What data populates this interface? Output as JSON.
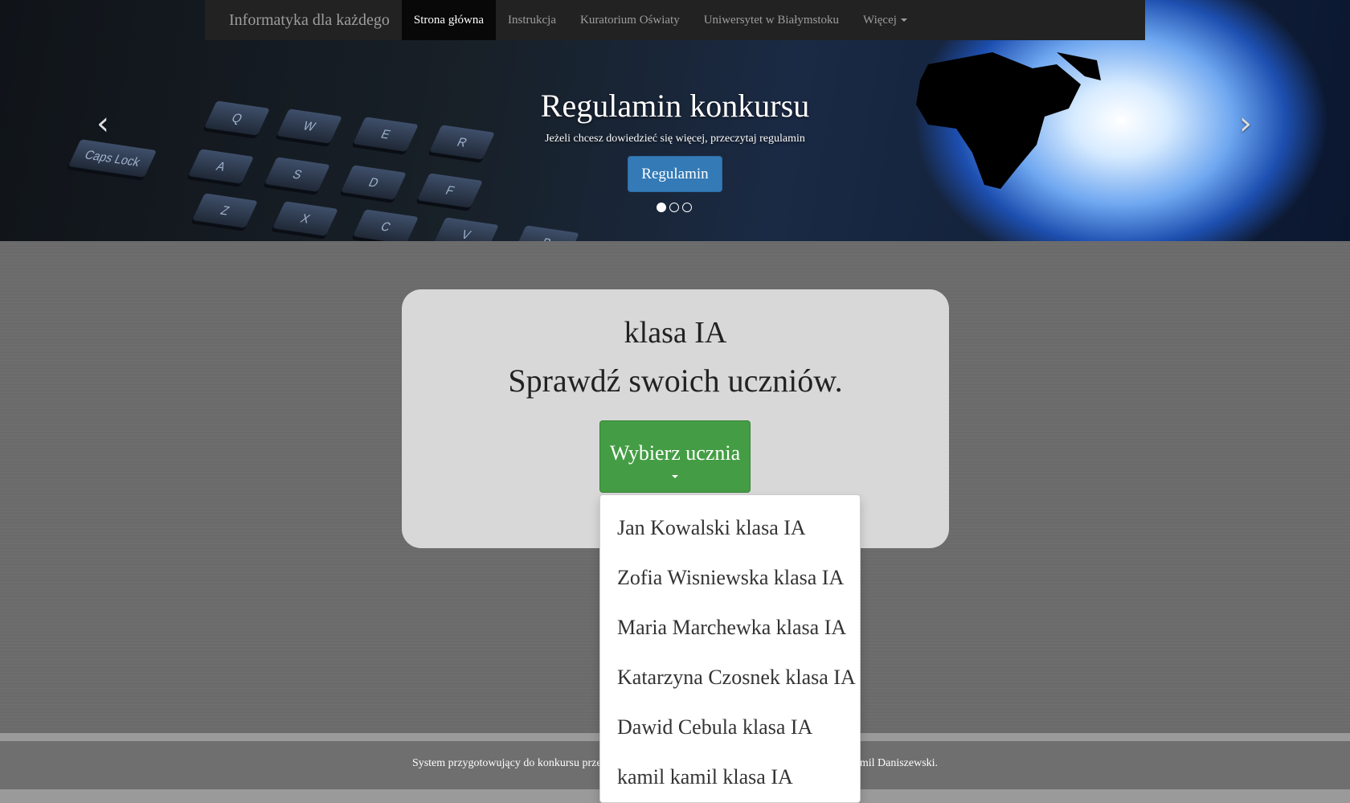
{
  "navbar": {
    "brand": "Informatyka dla każdego",
    "items": [
      {
        "label": "Strona główna",
        "active": true
      },
      {
        "label": "Instrukcja",
        "active": false
      },
      {
        "label": "Kuratorium Oświaty",
        "active": false
      },
      {
        "label": "Uniwersytet w Białymstoku",
        "active": false
      },
      {
        "label": "Więcej",
        "active": false,
        "dropdown": true
      }
    ]
  },
  "carousel": {
    "title": "Regulamin konkursu",
    "subtitle": "Jeżeli chcesz dowiedzieć się więcej, przeczytaj regulamin",
    "button_label": "Regulamin",
    "prev_icon": "chevron-left-icon",
    "next_icon": "chevron-right-icon",
    "slide_count": 3,
    "active_slide": 1
  },
  "keyboard_keys": [
    "Q",
    "W",
    "E",
    "R",
    "A",
    "S",
    "D",
    "F",
    "Z",
    "X",
    "C",
    "V",
    "B",
    "Caps Lock"
  ],
  "card": {
    "title": "klasa IA",
    "subtitle": "Sprawdź swoich uczniów.",
    "select_button": "Wybierz ucznia"
  },
  "students": [
    "Jan Kowalski klasa IA",
    "Zofia Wisniewska klasa IA",
    "Maria Marchewka klasa IA",
    "Katarzyna Czosnek klasa IA",
    "Dawid Cebula klasa IA",
    "kamil kamil klasa IA"
  ],
  "footer": {
    "text": "System przygotowujący do konkursu przedmiotowego z informatyki dla szkoły podstawowej © Kamil Daniszewski."
  },
  "colors": {
    "navbar_bg": "#222222",
    "primary_button": "#337ab7",
    "success_button": "#449d44",
    "card_bg": "#d8d8d8"
  }
}
